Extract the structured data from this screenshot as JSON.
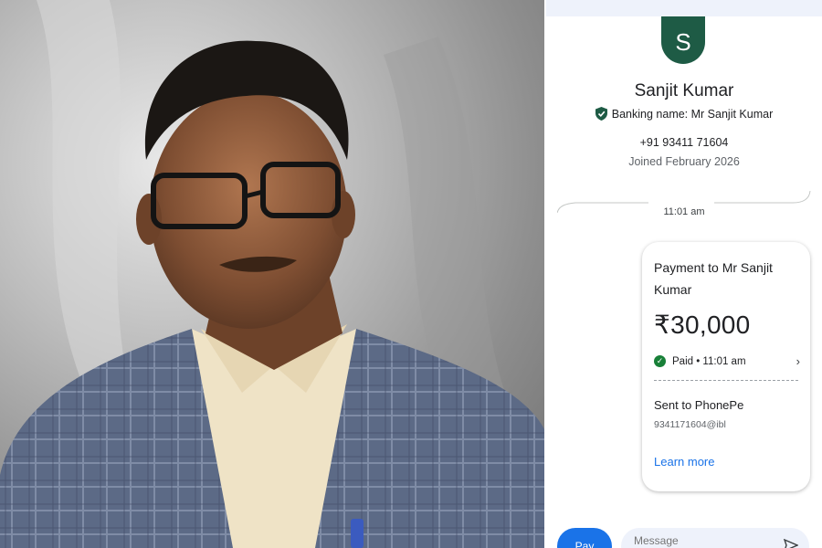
{
  "payment_screen": {
    "avatar_initial": "S",
    "contact_name": "Sanjit Kumar",
    "banking_name": "Banking name: Mr Sanjit Kumar",
    "phone_number": "+91 93411 71604",
    "joined": "Joined February 2026",
    "timestamp": "11:01 am",
    "card": {
      "title": "Payment to Mr Sanjit Kumar",
      "amount": "₹30,000",
      "status": "Paid • 11:01 am",
      "sent_to": "Sent to PhonePe",
      "vpa": "9341171604@ibl",
      "learn_more": "Learn more"
    },
    "pay_label": "Pay",
    "message_placeholder": "Message"
  },
  "colors": {
    "avatar_bg": "#1e5b45",
    "paid_green": "#188038",
    "link_blue": "#1a73e8",
    "input_bg": "#eef2fb"
  },
  "icons": [
    "shield-icon",
    "check-icon",
    "chevron-right-icon",
    "send-icon"
  ]
}
